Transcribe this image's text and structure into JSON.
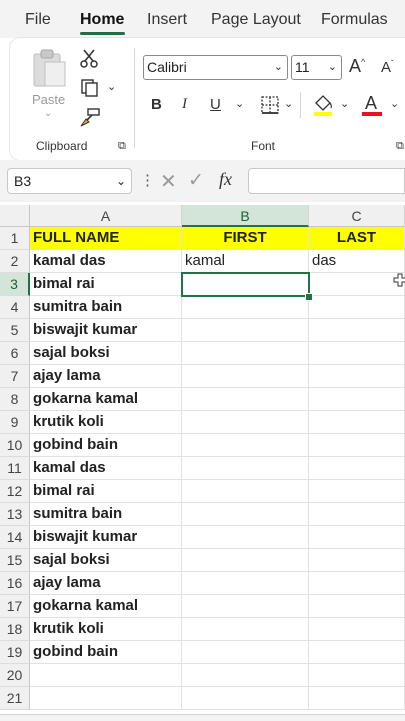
{
  "tabs": [
    {
      "label": "File"
    },
    {
      "label": "Home",
      "active": true
    },
    {
      "label": "Insert"
    },
    {
      "label": "Page Layout"
    },
    {
      "label": "Formulas"
    }
  ],
  "ribbon": {
    "clipboard": {
      "paste_label": "Paste",
      "group_label": "Clipboard"
    },
    "font": {
      "name": "Calibri",
      "size": "11",
      "group_label": "Font",
      "bold": "B",
      "italic": "I",
      "underline": "U",
      "font_color_letter": "A"
    }
  },
  "formula_bar": {
    "name_box": "B3",
    "fx_label": "fx",
    "content": ""
  },
  "columns": [
    "A",
    "B",
    "C"
  ],
  "rows": [
    {
      "n": "1",
      "a": "FULL NAME",
      "b": "FIRST",
      "c": "LAST"
    },
    {
      "n": "2",
      "a": "kamal das",
      "b": "kamal",
      "c": "das"
    },
    {
      "n": "3",
      "a": "bimal rai",
      "b": "",
      "c": ""
    },
    {
      "n": "4",
      "a": "sumitra bain",
      "b": "",
      "c": ""
    },
    {
      "n": "5",
      "a": "biswajit kumar",
      "b": "",
      "c": ""
    },
    {
      "n": "6",
      "a": "sajal boksi",
      "b": "",
      "c": ""
    },
    {
      "n": "7",
      "a": "ajay lama",
      "b": "",
      "c": ""
    },
    {
      "n": "8",
      "a": "gokarna kamal",
      "b": "",
      "c": ""
    },
    {
      "n": "9",
      "a": "krutik koli",
      "b": "",
      "c": ""
    },
    {
      "n": "10",
      "a": "gobind bain",
      "b": "",
      "c": ""
    },
    {
      "n": "11",
      "a": "kamal das",
      "b": "",
      "c": ""
    },
    {
      "n": "12",
      "a": "bimal rai",
      "b": "",
      "c": ""
    },
    {
      "n": "13",
      "a": "sumitra bain",
      "b": "",
      "c": ""
    },
    {
      "n": "14",
      "a": "biswajit kumar",
      "b": "",
      "c": ""
    },
    {
      "n": "15",
      "a": "sajal boksi",
      "b": "",
      "c": ""
    },
    {
      "n": "16",
      "a": "ajay lama",
      "b": "",
      "c": ""
    },
    {
      "n": "17",
      "a": "gokarna kamal",
      "b": "",
      "c": ""
    },
    {
      "n": "18",
      "a": "krutik koli",
      "b": "",
      "c": ""
    },
    {
      "n": "19",
      "a": "gobind bain",
      "b": "",
      "c": ""
    },
    {
      "n": "20",
      "a": "",
      "b": "",
      "c": ""
    },
    {
      "n": "21",
      "a": "",
      "b": "",
      "c": ""
    }
  ],
  "selected_cell": "B3",
  "colors": {
    "header_fill": "#ffff00",
    "accent": "#217346",
    "highlight": "#ffff00",
    "font_red": "#e81123"
  }
}
